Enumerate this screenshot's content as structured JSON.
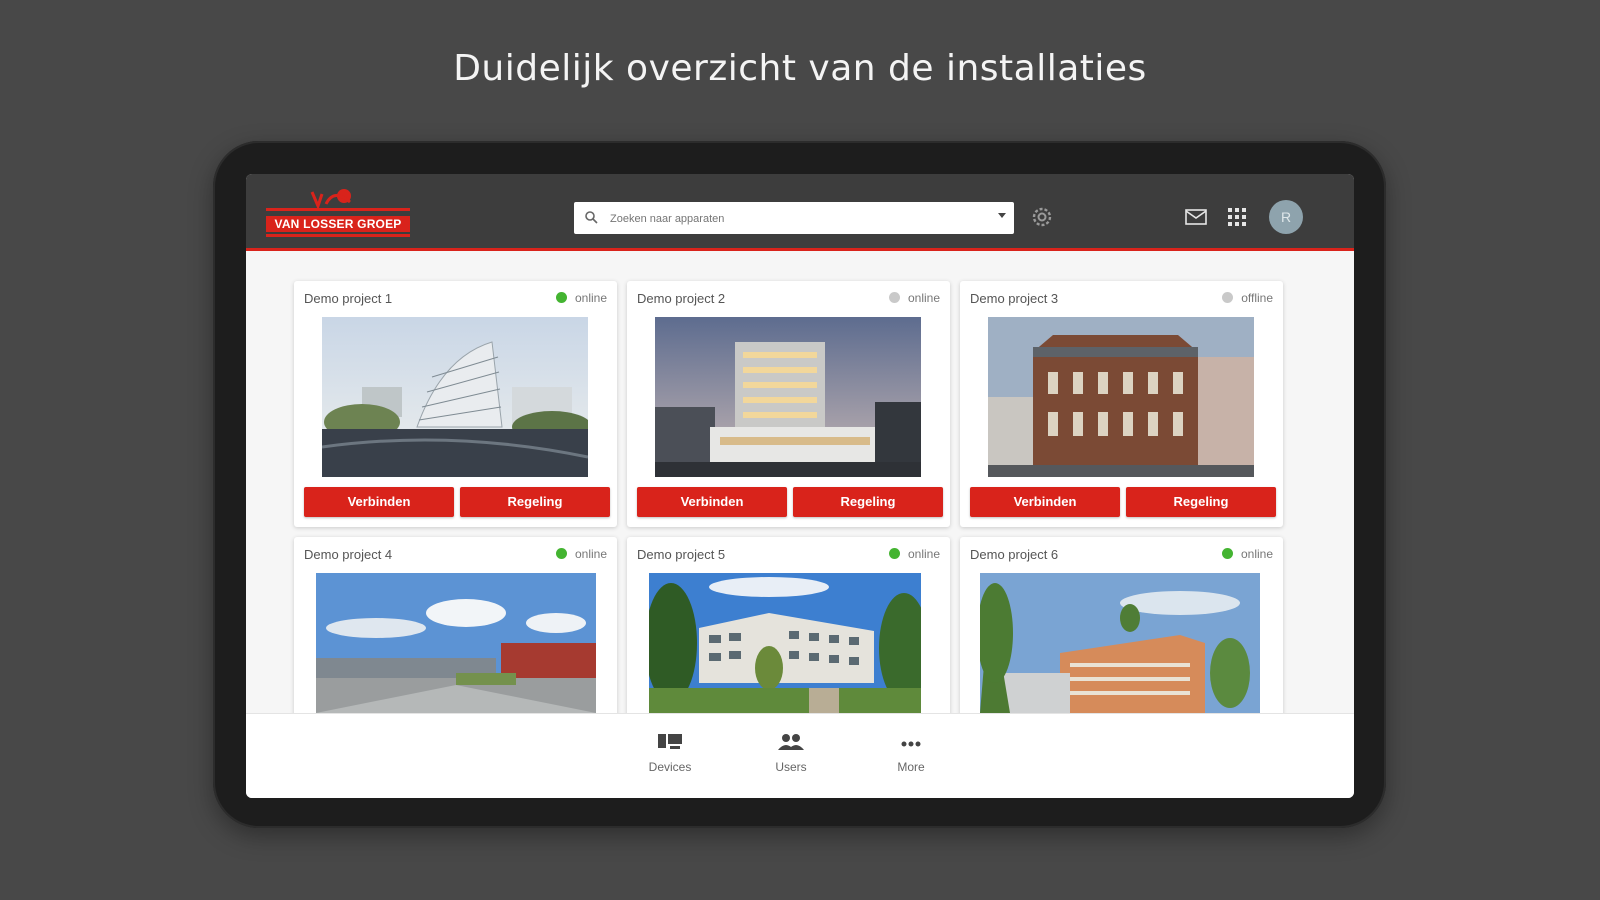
{
  "headline": "Duidelijk overzicht van de installaties",
  "brand": {
    "logo_text": "VAN LOSSER GROEP",
    "accent_color": "#d9231b"
  },
  "search": {
    "placeholder": "Zoeken naar apparaten"
  },
  "header_icons": [
    "search-icon",
    "chevron-down-icon",
    "gear-icon",
    "mail-icon",
    "apps-grid-icon"
  ],
  "user": {
    "avatar_initial": "R"
  },
  "projects": [
    {
      "name": "Demo project 1",
      "status": "online",
      "status_color": "#44b431",
      "connect_label": "Verbinden",
      "control_label": "Regeling"
    },
    {
      "name": "Demo project 2",
      "status": "online",
      "status_color": "#c9c9c9",
      "connect_label": "Verbinden",
      "control_label": "Regeling"
    },
    {
      "name": "Demo project 3",
      "status": "offline",
      "status_color": "#c9c9c9",
      "connect_label": "Verbinden",
      "control_label": "Regeling"
    },
    {
      "name": "Demo project 4",
      "status": "online",
      "status_color": "#44b431"
    },
    {
      "name": "Demo project 5",
      "status": "online",
      "status_color": "#44b431"
    },
    {
      "name": "Demo project 6",
      "status": "online",
      "status_color": "#44b431"
    }
  ],
  "bottom_nav": [
    {
      "label": "Devices",
      "icon": "devices-icon"
    },
    {
      "label": "Users",
      "icon": "users-icon"
    },
    {
      "label": "More",
      "icon": "more-icon"
    }
  ]
}
